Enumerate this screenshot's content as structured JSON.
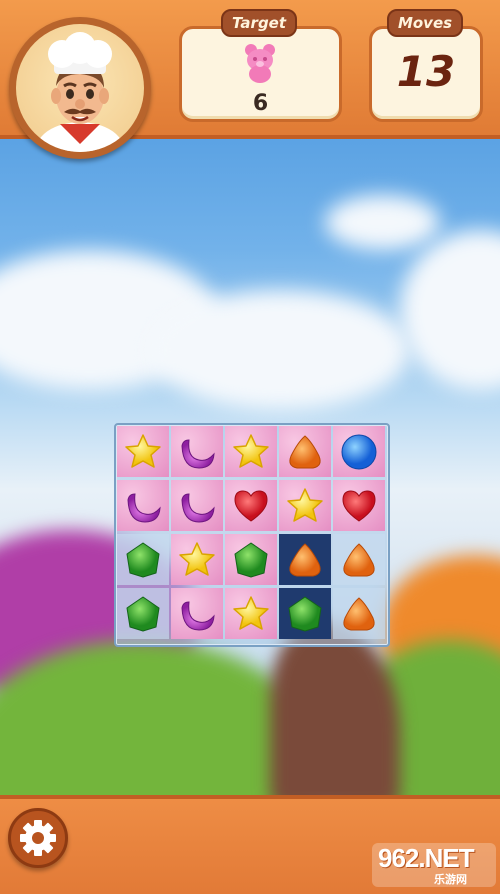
{
  "hud": {
    "target_label": "Target",
    "target_count": "6",
    "target_icon": "pink-bear-candy-icon",
    "moves_label": "Moves",
    "moves_value": "13"
  },
  "avatar": {
    "icon": "chef-avatar"
  },
  "board": {
    "rows": 4,
    "cols": 5,
    "pieces": [
      [
        "yellow-star",
        "purple-moon",
        "yellow-star",
        "orange-drop",
        "blue-ball"
      ],
      [
        "purple-moon",
        "purple-moon",
        "red-heart",
        "yellow-star",
        "red-heart"
      ],
      [
        "green-square",
        "yellow-star",
        "green-square",
        "orange-drop",
        "orange-drop"
      ],
      [
        "green-square",
        "purple-moon",
        "yellow-star",
        "green-square",
        "orange-drop"
      ]
    ],
    "tiles": [
      [
        "pink",
        "pink",
        "pink",
        "pink",
        "pink"
      ],
      [
        "pink",
        "pink",
        "pink",
        "pink",
        "pink"
      ],
      [
        "pale",
        "pink",
        "pink",
        "dark",
        "pale"
      ],
      [
        "pale",
        "pink",
        "pink",
        "dark",
        "pale"
      ]
    ]
  },
  "settings": {
    "icon": "gear-icon"
  },
  "watermark": {
    "main": "962.NET",
    "sub": "乐游网"
  },
  "colors": {
    "orange": "#e8843a",
    "brown": "#a1502a",
    "panel": "#fdf4df"
  }
}
